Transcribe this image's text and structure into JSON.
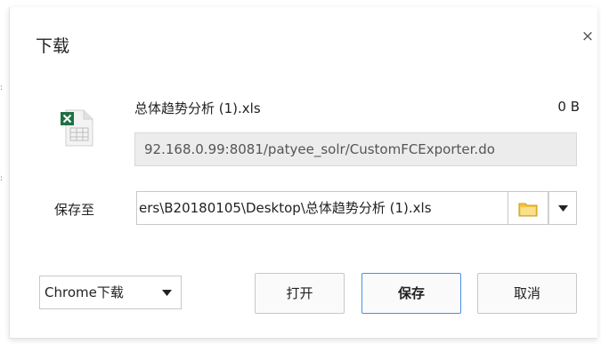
{
  "dialog": {
    "title": "下载",
    "close_glyph": "×"
  },
  "file": {
    "name": "总体趋势分析 (1).xls",
    "size": "0 B",
    "icon": "excel-file-icon",
    "url": "92.168.0.99:8081/patyee_solr/CustomFCExporter.do"
  },
  "save_location": {
    "label": "保存至",
    "path": "ers\\B20180105\\Desktop\\总体趋势分析 (1).xls",
    "folder_icon": "folder-icon",
    "dropdown_icon": "chevron-down-icon"
  },
  "footer": {
    "download_manager": {
      "selected": "Chrome下载",
      "icon": "chevron-down-icon"
    },
    "open_label": "打开",
    "save_label": "保存",
    "cancel_label": "取消"
  },
  "colors": {
    "primary_border": "#4a8fe8",
    "excel_green": "#1e7145",
    "folder_yellow": "#f5c33b",
    "url_field_bg": "#ececec"
  }
}
